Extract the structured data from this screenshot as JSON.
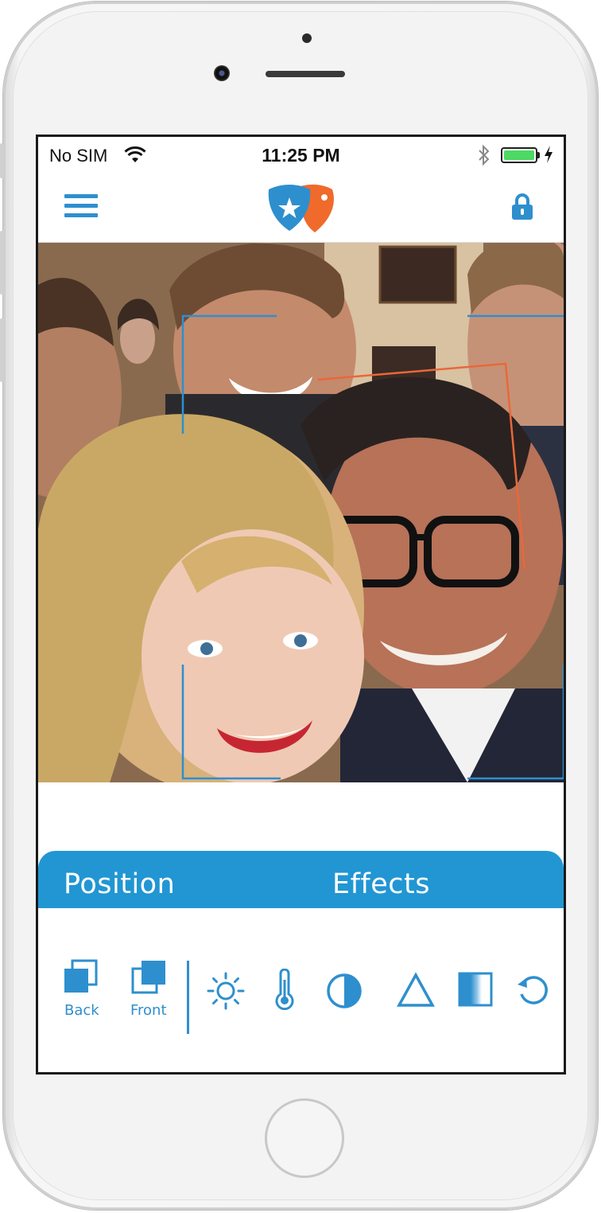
{
  "status_bar": {
    "carrier": "No SIM",
    "time": "11:25 PM",
    "battery_level": 1.0,
    "icons": [
      "wifi-icon",
      "bluetooth-icon",
      "battery-icon",
      "charging-icon"
    ]
  },
  "nav_bar": {
    "left_icon": "hamburger-menu-icon",
    "center_icon": "app-logo-icon",
    "right_icon": "lock-icon"
  },
  "photo": {
    "description_icon": "group-selfie-photo",
    "face_box_colors": [
      "#2e8fce",
      "#e8683a"
    ]
  },
  "tabs": [
    {
      "label": "Position"
    },
    {
      "label": "Effects"
    }
  ],
  "position_tools": [
    {
      "label": "Back",
      "icon": "send-to-back-icon"
    },
    {
      "label": "Front",
      "icon": "bring-to-front-icon"
    }
  ],
  "effect_tools": [
    {
      "icon": "brightness-icon"
    },
    {
      "icon": "temperature-icon"
    },
    {
      "icon": "contrast-icon"
    },
    {
      "icon": "sharpen-triangle-icon"
    },
    {
      "icon": "gradient-icon"
    },
    {
      "icon": "reset-icon"
    }
  ],
  "colors": {
    "accent": "#2196d3",
    "icon_blue": "#2e8fce",
    "logo_orange": "#f06a2c",
    "battery_green": "#4cd964"
  }
}
